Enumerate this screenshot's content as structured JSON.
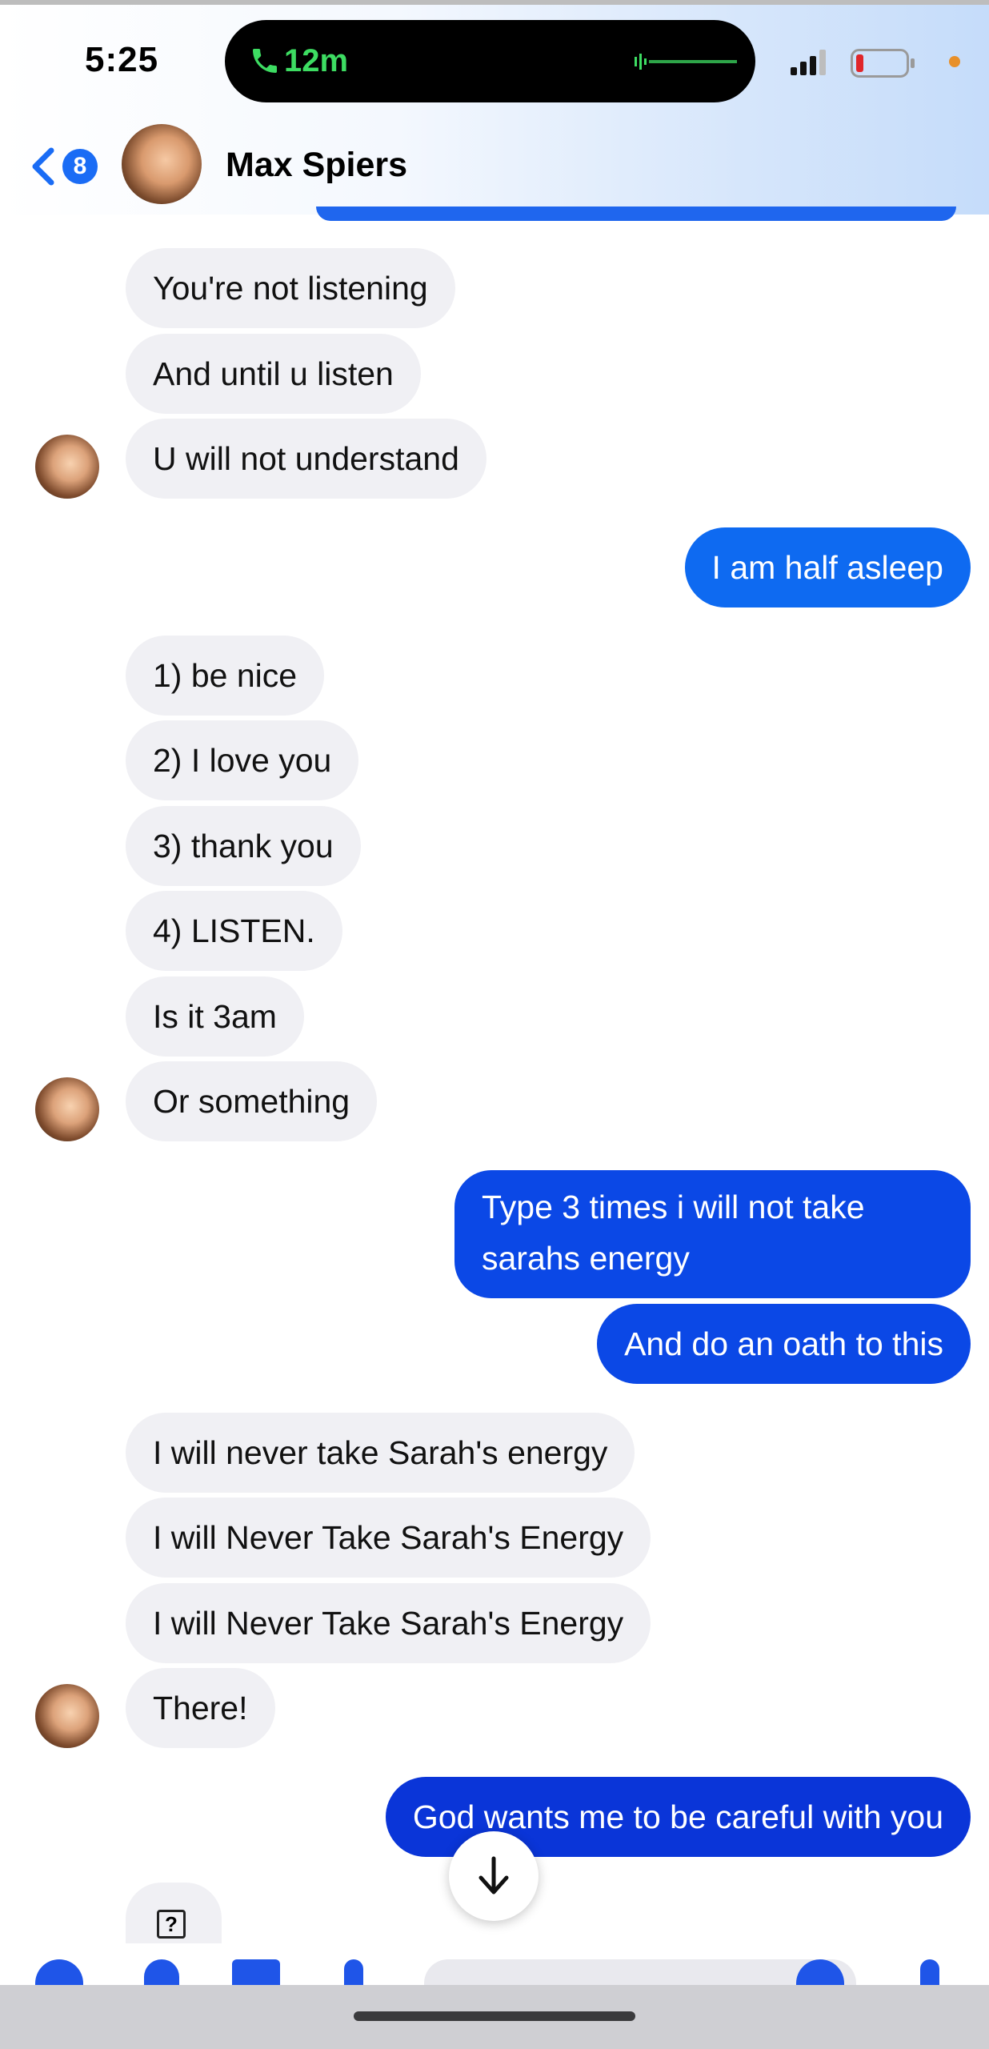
{
  "status_bar": {
    "time": "5:25",
    "call_duration": "12m",
    "call_color": "#3ddc62",
    "battery_level_color": "#e0262a",
    "privacy_dot_color": "#e8902a"
  },
  "header": {
    "back_count": "8",
    "contact_name": "Max Spiers",
    "accent": "#1a6cf5"
  },
  "messages": [
    {
      "side": "incoming",
      "text": "You're not listening"
    },
    {
      "side": "incoming",
      "text": "And until u listen"
    },
    {
      "side": "incoming",
      "text": "U will not understand"
    },
    {
      "side": "outgoing",
      "text": "I am half asleep"
    },
    {
      "side": "incoming",
      "text": "1) be nice"
    },
    {
      "side": "incoming",
      "text": "2) I love you"
    },
    {
      "side": "incoming",
      "text": "3) thank you"
    },
    {
      "side": "incoming",
      "text": "4) LISTEN."
    },
    {
      "side": "incoming",
      "text": "Is it 3am"
    },
    {
      "side": "incoming",
      "text": "Or something"
    },
    {
      "side": "outgoing",
      "text": "Type 3 times i will not take sarahs energy"
    },
    {
      "side": "outgoing",
      "text": "And do an oath to this"
    },
    {
      "side": "incoming",
      "text": "I will never take Sarah's energy"
    },
    {
      "side": "incoming",
      "text": "I will Never Take Sarah's Energy"
    },
    {
      "side": "incoming",
      "text": "I will Never Take Sarah's Energy"
    },
    {
      "side": "incoming",
      "text": "There!"
    },
    {
      "side": "outgoing",
      "text": "God wants me to be careful with you"
    }
  ],
  "icons": {
    "back": "chevron-left-icon",
    "scroll_down": "arrow-down-icon",
    "help": "question-box-icon"
  }
}
